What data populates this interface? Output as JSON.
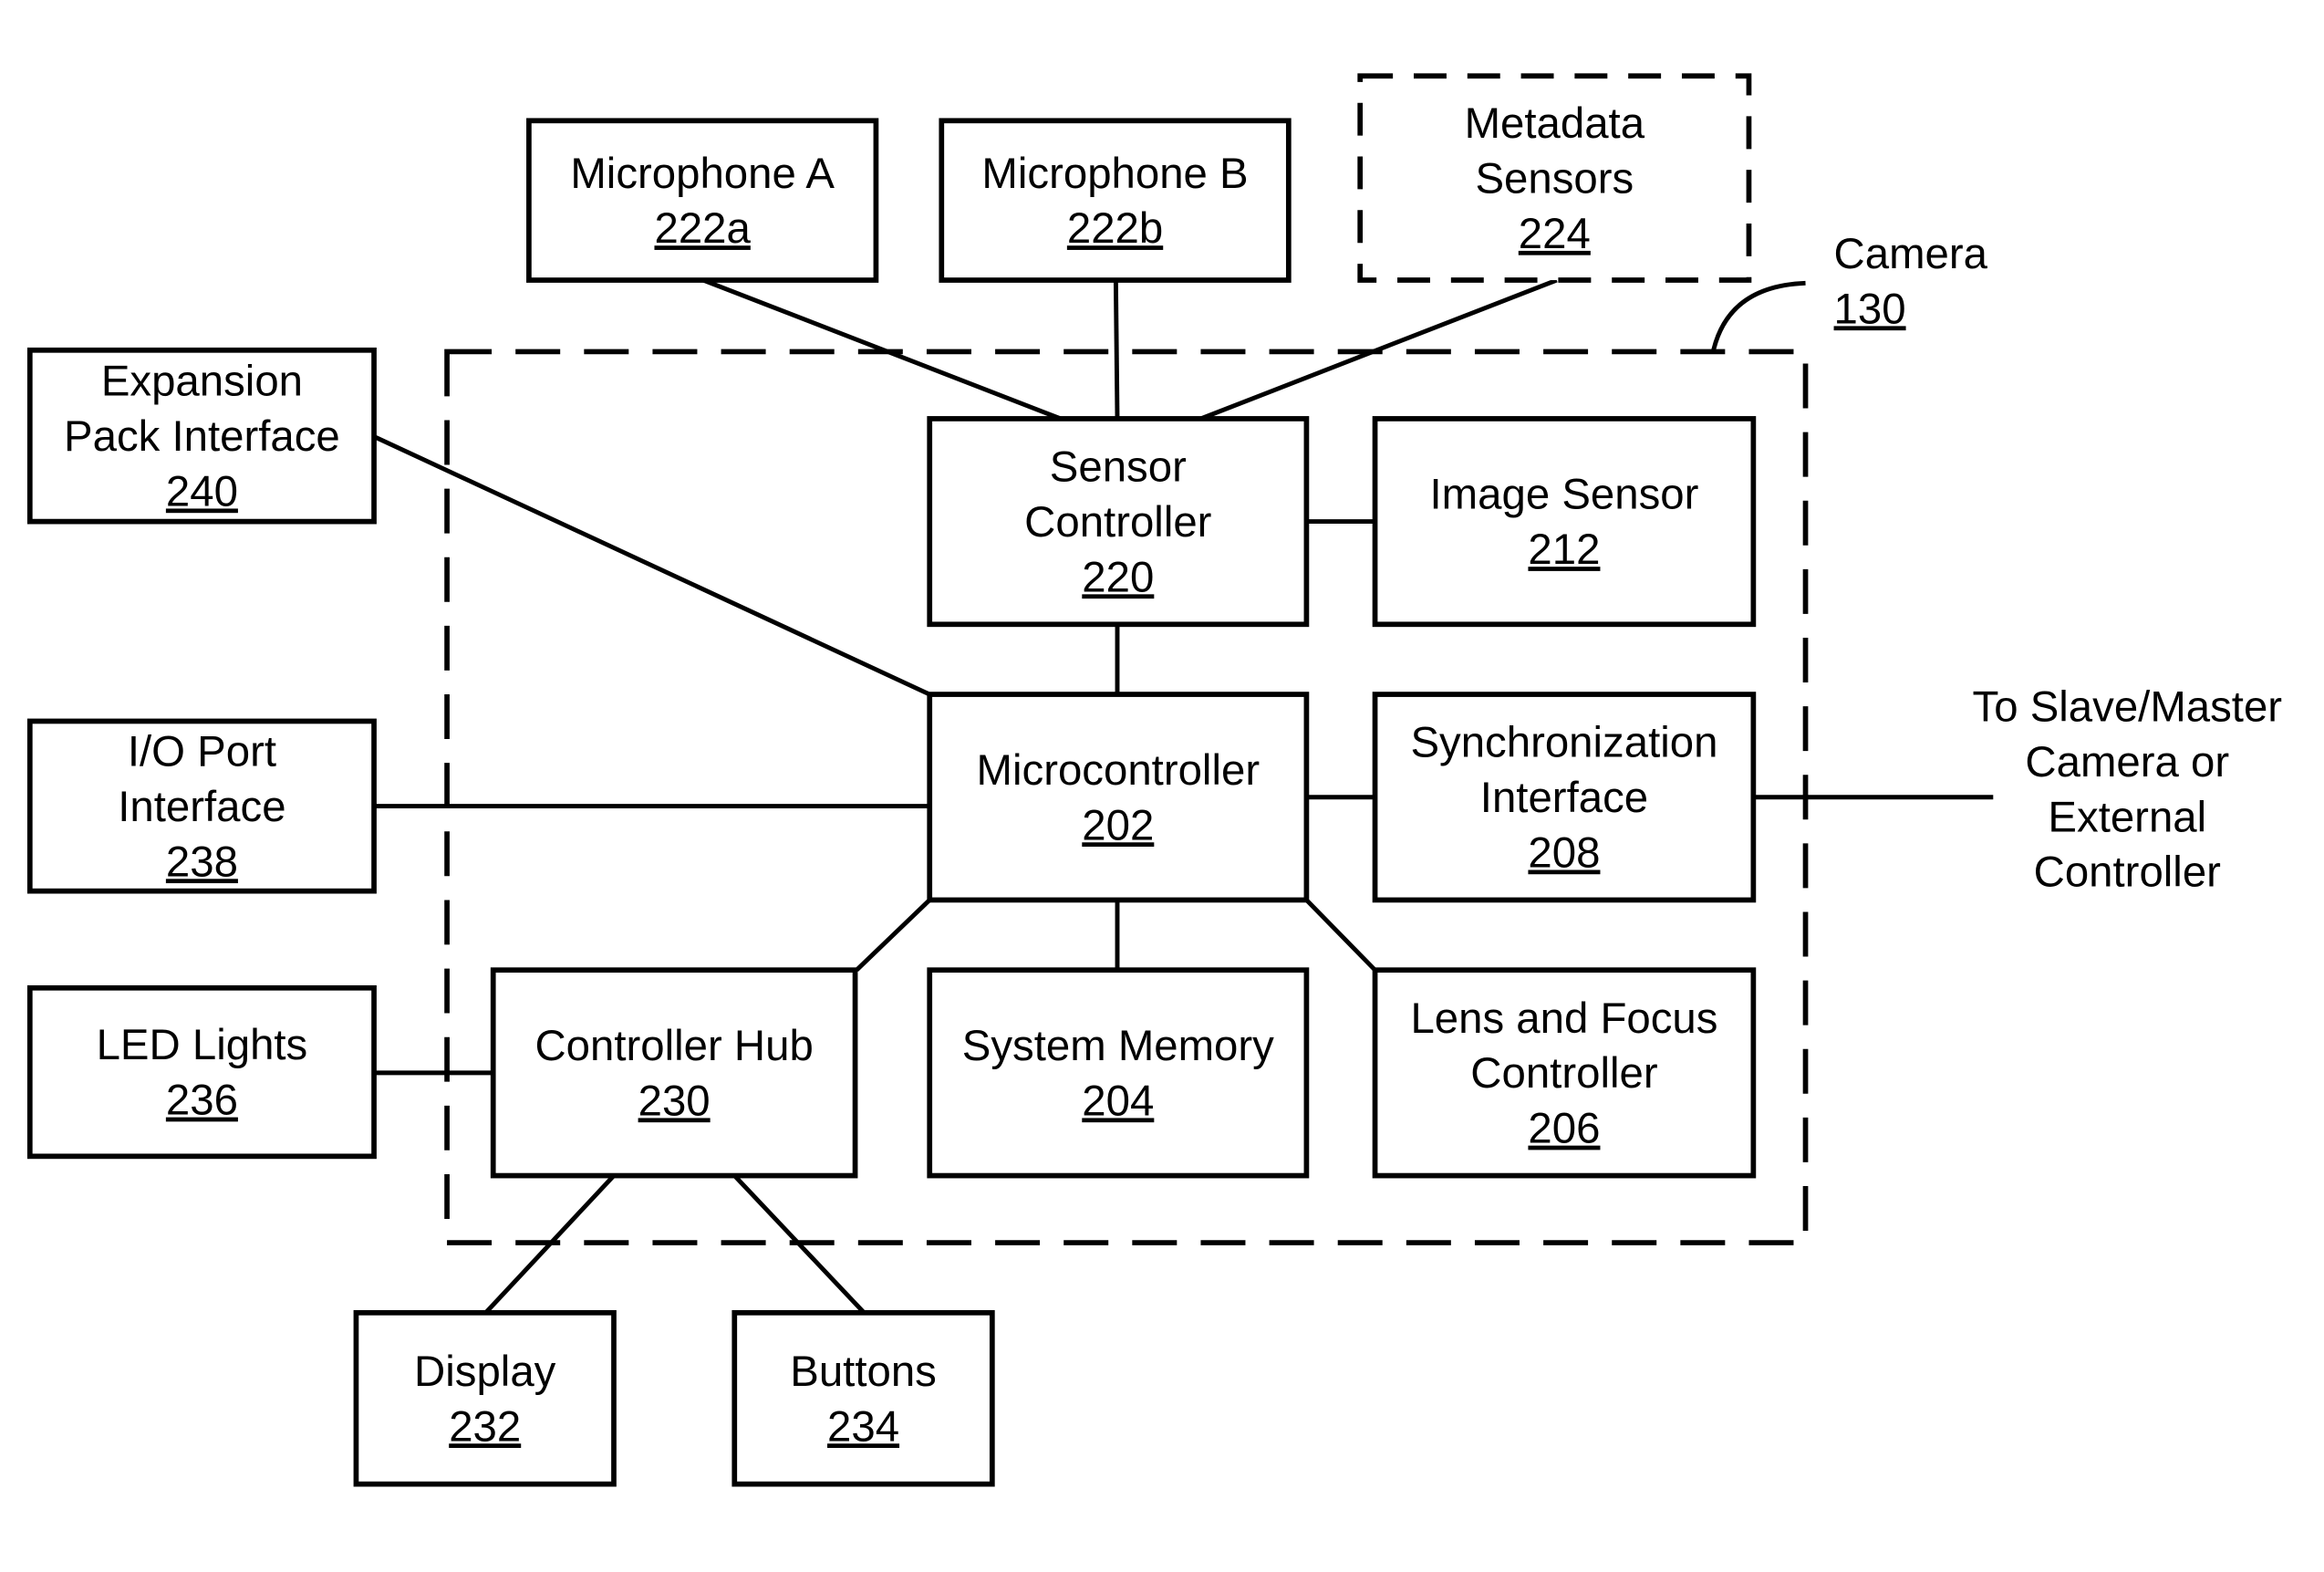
{
  "diagram": {
    "camera": {
      "title": "Camera",
      "ref": "130"
    },
    "external_label": [
      "To Slave/Master",
      "Camera or",
      "External",
      "Controller"
    ],
    "blocks": {
      "mic_a": {
        "lines": [
          "Microphone A"
        ],
        "ref": "222a"
      },
      "mic_b": {
        "lines": [
          "Microphone B"
        ],
        "ref": "222b"
      },
      "metadata": {
        "lines": [
          "Metadata",
          "Sensors"
        ],
        "ref": "224",
        "optional": true
      },
      "expansion": {
        "lines": [
          "Expansion",
          "Pack Interface"
        ],
        "ref": "240"
      },
      "sensor_ctrl": {
        "lines": [
          "Sensor",
          "Controller"
        ],
        "ref": "220"
      },
      "image_sensor": {
        "lines": [
          "Image Sensor"
        ],
        "ref": "212"
      },
      "io_port": {
        "lines": [
          "I/O Port",
          "Interface"
        ],
        "ref": "238"
      },
      "micro": {
        "lines": [
          "Microcontroller"
        ],
        "ref": "202"
      },
      "sync": {
        "lines": [
          "Synchronization",
          "Interface"
        ],
        "ref": "208"
      },
      "led": {
        "lines": [
          "LED Lights"
        ],
        "ref": "236"
      },
      "hub": {
        "lines": [
          "Controller Hub"
        ],
        "ref": "230"
      },
      "memory": {
        "lines": [
          "System Memory"
        ],
        "ref": "204"
      },
      "lens": {
        "lines": [
          "Lens and Focus",
          "Controller"
        ],
        "ref": "206"
      },
      "display": {
        "lines": [
          "Display"
        ],
        "ref": "232"
      },
      "buttons": {
        "lines": [
          "Buttons"
        ],
        "ref": "234"
      }
    }
  }
}
